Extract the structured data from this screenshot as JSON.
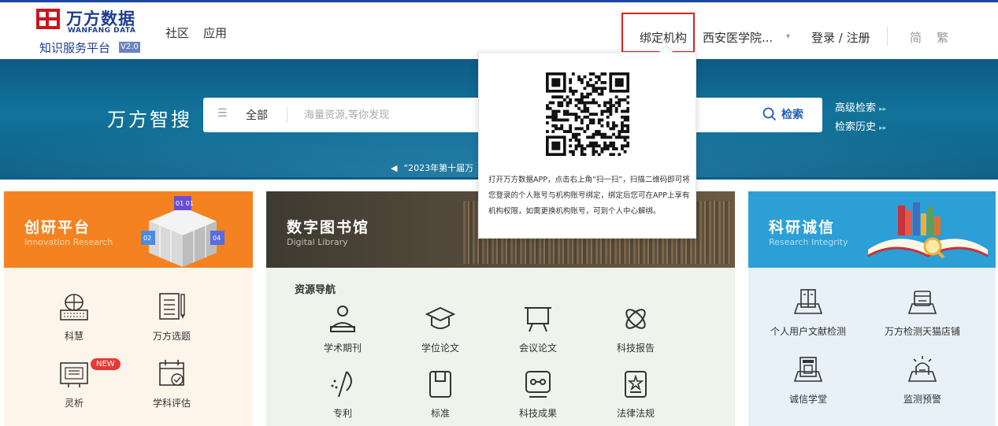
{
  "header": {
    "logo": {
      "cn": "万方数据",
      "en": "WANFANG DATA",
      "subtitle": "知识服务平台",
      "version": "V2.0"
    },
    "nav": [
      "社区",
      "应用"
    ],
    "bind_institution": "绑定机构",
    "institution": "西安医学院...",
    "institution_caret": "▾",
    "login": "登录 / 注册",
    "simplified": "简",
    "traditional": "繁"
  },
  "search": {
    "title": "万方智搜",
    "scope": "全部",
    "placeholder": "海量资源,等你发现",
    "button": "检索",
    "advanced": "高级检索",
    "history": "检索历史",
    "ticker": "“2023年第十届万"
  },
  "popup": {
    "text": "打开万方数据APP，点击右上角“扫一扫”，扫描二维码即可将您登录的个人账号与机构账号绑定，绑定后您可在APP上享有机构权限，如需更换机构账号，可到个人中心解绑。"
  },
  "cards": {
    "innovation": {
      "title": "创研平台",
      "subtitle": "Innovation Research",
      "items": [
        "科慧",
        "万方选题",
        "灵析",
        "学科评估"
      ],
      "new_badge": "NEW",
      "cube_labels": [
        "01 01",
        "02",
        "04"
      ]
    },
    "library": {
      "title": "数字图书馆",
      "subtitle": "Digital Library",
      "nav_title": "资源导航",
      "items": [
        "学术期刊",
        "学位论文",
        "会议论文",
        "科技报告",
        "专利",
        "标准",
        "科技成果",
        "法律法规"
      ]
    },
    "integrity": {
      "title": "科研诚信",
      "subtitle": "Research Integrity",
      "items": [
        "个人用户文献检测",
        "万方检测天猫店铺",
        "诚信学堂",
        "监测预警"
      ]
    }
  },
  "colors": {
    "brand_red": "#c8161d",
    "brand_blue": "#1f3e8f",
    "orange": "#f58220",
    "teal": "#2b9fd6",
    "library_dark": "#4a4035",
    "highlight_red": "#e02020"
  }
}
